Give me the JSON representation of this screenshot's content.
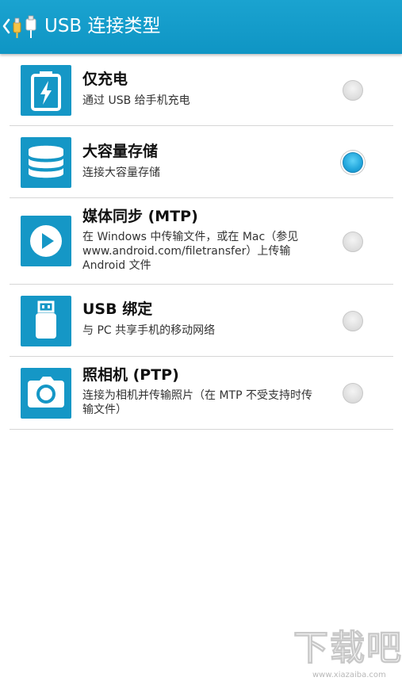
{
  "header": {
    "title": "USB 连接类型",
    "back_icon": "chevron-left-icon",
    "app_icon": "usb-cable-icon",
    "color": "#129bc9"
  },
  "options": [
    {
      "title": "仅充电",
      "desc": "通过 USB 给手机充电",
      "icon": "battery-icon",
      "checked": false
    },
    {
      "title": "大容量存储",
      "desc": "连接大容量存储",
      "icon": "database-icon",
      "checked": true
    },
    {
      "title": "媒体同步 (MTP)",
      "desc": "在 Windows 中传输文件，或在 Mac（参见 www.android.com/filetransfer）上传输 Android 文件",
      "icon": "play-icon",
      "checked": false
    },
    {
      "title": "USB 绑定",
      "desc": "与 PC 共享手机的移动网络",
      "icon": "usb-stick-icon",
      "checked": false
    },
    {
      "title": "照相机 (PTP)",
      "desc": "连接为相机并传输照片（在 MTP 不受支持时传输文件）",
      "icon": "camera-icon",
      "checked": false
    }
  ],
  "watermark": {
    "text": "下载吧",
    "url": "www.xiazaiba.com"
  },
  "colors": {
    "accent": "#1597c6",
    "radio_checked": "#22a6dc"
  }
}
